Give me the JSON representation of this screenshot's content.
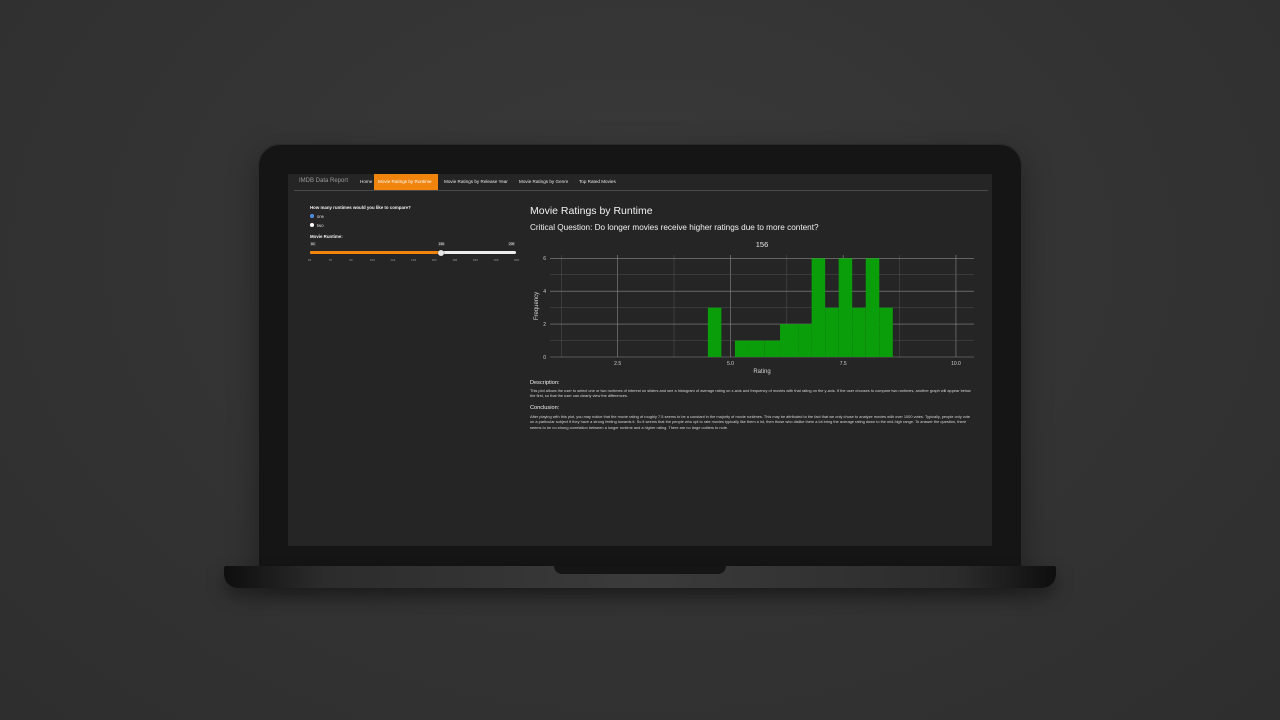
{
  "app": {
    "brand": "IMDB Data Report",
    "tabs": [
      {
        "label": "Home",
        "active": false
      },
      {
        "label": "Movie Ratings by Runtime",
        "active": true
      },
      {
        "label": "Movie Ratings by Release Year",
        "active": false
      },
      {
        "label": "Movie Ratings by Genre",
        "active": false
      },
      {
        "label": "Top Rated Movies",
        "active": false
      }
    ]
  },
  "sidebar": {
    "question": "How many runtimes would you like to compare?",
    "options": [
      {
        "label": "one",
        "selected": true
      },
      {
        "label": "two",
        "selected": false
      }
    ],
    "slider_label": "Movie Runtime:",
    "slider": {
      "min": 64,
      "max": 209,
      "value": 156,
      "min_label": "64",
      "max_label": "209",
      "value_label": "156",
      "ticks": [
        "64",
        "79",
        "94",
        "109",
        "124",
        "139",
        "154",
        "169",
        "184",
        "199",
        "209"
      ]
    }
  },
  "main": {
    "title": "Movie Ratings by Runtime",
    "question": "Critical Question: Do longer movies receive higher ratings due to more content?",
    "description_head": "Description:",
    "description": "This plot allows the user to select one or two runtimes of interest on sliders and see a histogram of average rating on x-axis and frequency of movies with that rating on the y-axis. If the user chooses to compare two runtimes, another graph will appear below the first, so that the user can clearly view the differences.",
    "conclusion_head": "Conclusion:",
    "conclusion": "After playing with this plot, you may notice that the movie rating of roughly 7.5 seems to be a constant in the majority of movie runtimes. This may be attributed to the fact that we only chose to analyze movies with over 1000 votes. Typically, people only vote on a particular subject if they have a strong feeling towards it. So it seems that the people who opt to rate movies typically like them a lot, then those who dislike them a lot bring the average rating down to the mid-high range. To answer the question, there seems to be no strong correlation between a longer runtime and a higher rating. There are no large outliers to note."
  },
  "colors": {
    "accent": "#f0840c",
    "bar": "#0a9e0a",
    "screen_bg": "#252525"
  },
  "chart_data": {
    "type": "bar",
    "title": "156",
    "xlabel": "Rating",
    "ylabel": "Frequency",
    "xlim": [
      1.0,
      10.4
    ],
    "ylim": [
      0,
      6.2
    ],
    "xticks": [
      2.5,
      5.0,
      7.5,
      10.0
    ],
    "xtick_labels": [
      "2.5",
      "5.0",
      "7.5",
      "10.0"
    ],
    "yticks": [
      0,
      2,
      4,
      6
    ],
    "ytick_labels": [
      "0",
      "2",
      "4",
      "6"
    ],
    "grid": true,
    "bins": [
      {
        "x0": 4.5,
        "x1": 4.8,
        "count": 3
      },
      {
        "x0": 4.8,
        "x1": 5.1,
        "count": 0
      },
      {
        "x0": 5.1,
        "x1": 5.4,
        "count": 1
      },
      {
        "x0": 5.4,
        "x1": 5.75,
        "count": 1
      },
      {
        "x0": 5.75,
        "x1": 6.1,
        "count": 1
      },
      {
        "x0": 6.1,
        "x1": 6.5,
        "count": 2
      },
      {
        "x0": 6.5,
        "x1": 6.8,
        "count": 2
      },
      {
        "x0": 6.8,
        "x1": 7.1,
        "count": 6
      },
      {
        "x0": 7.1,
        "x1": 7.4,
        "count": 3
      },
      {
        "x0": 7.4,
        "x1": 7.7,
        "count": 6
      },
      {
        "x0": 7.7,
        "x1": 8.0,
        "count": 3
      },
      {
        "x0": 8.0,
        "x1": 8.3,
        "count": 6
      },
      {
        "x0": 8.3,
        "x1": 8.6,
        "count": 3
      }
    ]
  }
}
